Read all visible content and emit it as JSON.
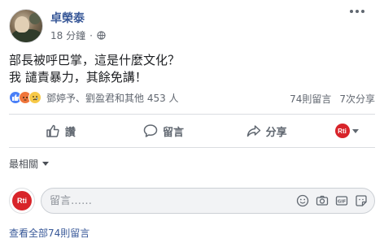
{
  "post": {
    "author": "卓榮泰",
    "time": "18 分鐘",
    "privacy_icon": "globe-icon",
    "line1": "部長被呼巴掌，這是什麼文化？",
    "line2": "我 譴責暴力，其餘免講！"
  },
  "reactions": {
    "types": [
      "like",
      "angry",
      "sad"
    ],
    "names": "鄧婷予、劉盈君和其他 453 人",
    "comments": "74則留言",
    "shares": "7次分享"
  },
  "actions": {
    "like": "讚",
    "comment": "留言",
    "share": "分享",
    "page_badge": "Rti"
  },
  "relevance": "最相關",
  "composer": {
    "avatar_badge": "Rti",
    "placeholder": "留言……",
    "icons": [
      "emoji-icon",
      "camera-icon",
      "gif-icon",
      "sticker-icon"
    ]
  },
  "view_all": "查看全部74則留言",
  "colors": {
    "link": "#385898",
    "like": "#4a7ff7",
    "angry": "#f0763b",
    "sad": "#f7c948",
    "badge": "#d8242a"
  }
}
